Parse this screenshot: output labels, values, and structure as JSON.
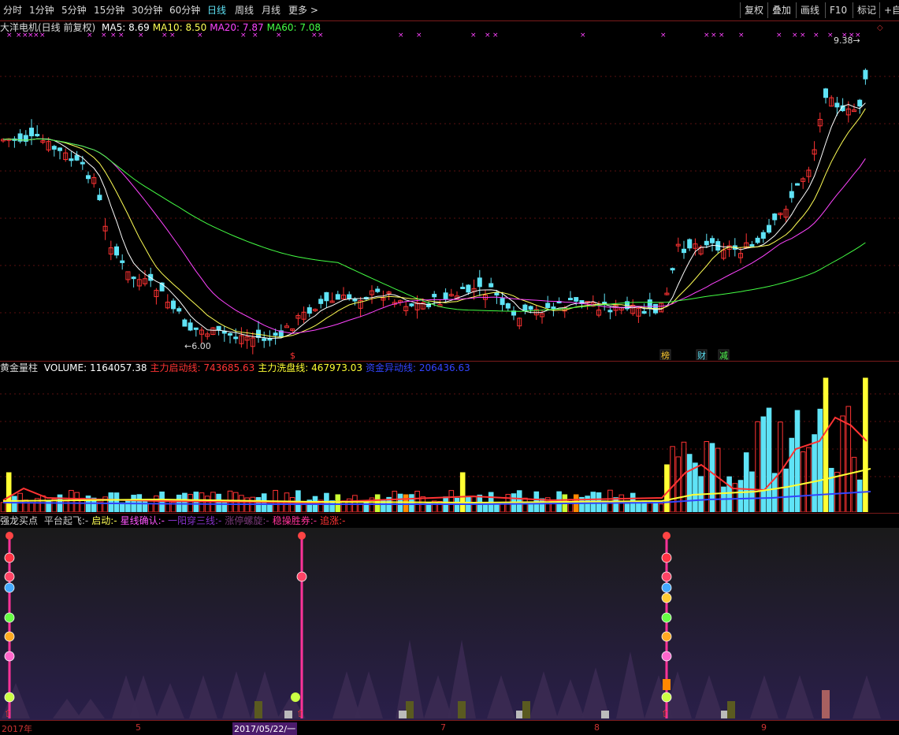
{
  "toolbar": {
    "timeframes": [
      "分时",
      "1分钟",
      "5分钟",
      "15分钟",
      "30分钟",
      "60分钟",
      "日线",
      "周线",
      "月线",
      "更多 >"
    ],
    "active_timeframe": "日线",
    "right_buttons": [
      "复权",
      "叠加",
      "画线",
      "F10",
      "标记",
      "+自选"
    ]
  },
  "chart_data": [
    {
      "type": "candlestick",
      "title": "大洋电机(日线 前复权)",
      "indicators": [
        {
          "name": "MA5",
          "value": "8.69",
          "color": "#ffffff"
        },
        {
          "name": "MA10",
          "value": "8.50",
          "color": "#ffff55"
        },
        {
          "name": "MA20",
          "value": "7.87",
          "color": "#ff44ff"
        },
        {
          "name": "MA60",
          "value": "7.08",
          "color": "#44ff44"
        }
      ],
      "annotations": {
        "high": "9.38",
        "low": "6.00"
      },
      "event_labels": [
        "榜",
        "财",
        "减"
      ],
      "signal_marker": "$"
    },
    {
      "type": "bar",
      "title": "黄金量柱",
      "indicators": [
        {
          "name": "VOLUME",
          "value": "1164057.38",
          "color": "#ffffff"
        },
        {
          "name": "主力启动线",
          "value": "743685.63",
          "color": "#ff3333"
        },
        {
          "name": "主力洗盘线",
          "value": "467973.03",
          "color": "#ffff33"
        },
        {
          "name": "资金异动线",
          "value": "206436.63",
          "color": "#3344ff"
        }
      ]
    },
    {
      "type": "bar",
      "title": "强龙买点",
      "indicators": [
        {
          "name": "平台起飞",
          "value": "-",
          "color": "#c8c8c8"
        },
        {
          "name": "启动",
          "value": "-",
          "color": "#ffff55"
        },
        {
          "name": "星线确认",
          "value": "-",
          "color": "#ff55ff"
        },
        {
          "name": "一阳穿三线",
          "value": "-",
          "color": "#8833cc"
        },
        {
          "name": "涨停螺旋",
          "value": "-",
          "color": "#7a3a7a"
        },
        {
          "name": "稳操胜券",
          "value": "-",
          "color": "#ff3399"
        },
        {
          "name": "追涨",
          "value": "-",
          "color": "#ff3333"
        }
      ]
    }
  ],
  "date_axis": {
    "labels": [
      "2017年",
      "5",
      "7",
      "8",
      "9"
    ],
    "cursor_date": "2017/05/22/一"
  },
  "colors": {
    "up": "#ff3333",
    "down": "#5fe3f6",
    "background": "#000000",
    "grid": "#7a1a1a",
    "accent": "#ff3399"
  }
}
